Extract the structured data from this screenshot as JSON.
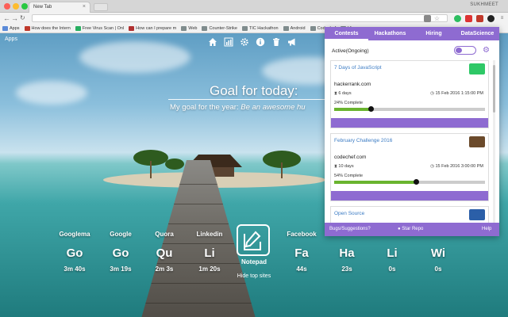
{
  "browser": {
    "tab_title": "New Tab",
    "profile_name": "SUKHMEET",
    "extension_icons": [
      {
        "name": "reload-icon"
      },
      {
        "name": "star-icon"
      },
      {
        "name": "evernote-icon"
      },
      {
        "name": "pushbullet-icon"
      },
      {
        "name": "pdf-icon"
      },
      {
        "name": "hackerrank-extension-icon"
      },
      {
        "name": "codechef-extension-icon"
      }
    ]
  },
  "bookmarks": [
    {
      "label": "Apps",
      "color": "#5a8ad8"
    },
    {
      "label": "How does the Intern",
      "color": "#c0392b"
    },
    {
      "label": "Free Virus Scan | Onl",
      "color": "#27ae60"
    },
    {
      "label": "How can I prepare m",
      "color": "#b03030"
    },
    {
      "label": "Web",
      "color": "#7f8c8d"
    },
    {
      "label": "Counter-Strike",
      "color": "#7f8c8d"
    },
    {
      "label": "TIC Hackathon",
      "color": "#7f8c8d"
    },
    {
      "label": "Android",
      "color": "#7f8c8d"
    },
    {
      "label": "Codechef",
      "color": "#7f8c8d"
    },
    {
      "label": "Vim"
    }
  ],
  "page": {
    "apps_label": "Apps",
    "top_icons": [
      "home-icon",
      "chart-icon",
      "gear-icon",
      "info-icon",
      "trash-icon",
      "megaphone-icon"
    ],
    "goal_title": "Goal for today:",
    "goal_prefix": "My goal for the year: ",
    "goal_text": "Be an awesome hu",
    "top_sites": [
      {
        "name": "Googlema",
        "abbr": "Go",
        "time": "3m 40s"
      },
      {
        "name": "Google",
        "abbr": "Go",
        "time": "3m 19s"
      },
      {
        "name": "Quora",
        "abbr": "Qu",
        "time": "2m 3s"
      },
      {
        "name": "Linkedin",
        "abbr": "Li",
        "time": "1m 20s"
      },
      {
        "name": "Facebook",
        "abbr": "Fa",
        "time": "44s"
      },
      {
        "name": "",
        "abbr": "Ha",
        "time": "23s"
      },
      {
        "name": "",
        "abbr": "Li",
        "time": "0s"
      },
      {
        "name": "",
        "abbr": "Wi",
        "time": "0s"
      }
    ],
    "notepad_label": "Notepad",
    "hide_sites_label": "Hide top sites"
  },
  "popup": {
    "tabs": [
      "Contests",
      "Hackathons",
      "Hiring",
      "DataScience"
    ],
    "active_label": "Active(Ongoing)",
    "contests": [
      {
        "title": "7 Days of JavaScript",
        "site": "hackerrank.com",
        "duration": "6 days",
        "end": "15 Feb 2016 1:15:00 PM",
        "progress_label": "24% Complete",
        "progress": 24,
        "logo_color": "#2ec866"
      },
      {
        "title": "February Challenge 2016",
        "site": "codechef.com",
        "duration": "10 days",
        "end": "15 Feb 2016 3:00:00 PM",
        "progress_label": "54% Complete",
        "progress": 54,
        "logo_color": "#6b4a2b"
      },
      {
        "title": "Open Source",
        "site": "",
        "duration": "",
        "end": "",
        "progress_label": "",
        "progress": 0,
        "logo_color": "#2b5fa8"
      }
    ],
    "footer": {
      "bugs": "Bugs/Suggestions?",
      "star": "Star Repo",
      "help": "Help"
    },
    "accent_color": "#8e6bd1",
    "progress_color": "#6ab42f"
  }
}
